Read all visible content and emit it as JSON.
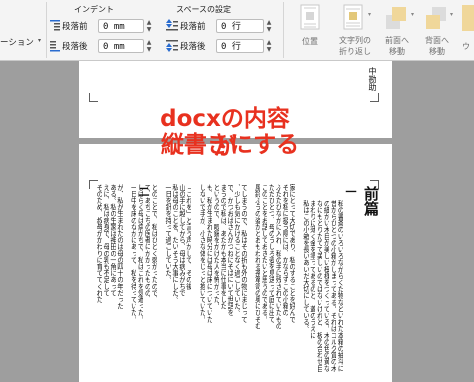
{
  "ribbon": {
    "left_cut_label": "ーション",
    "indent_title": "インデント",
    "spacing_title": "スペースの設定",
    "indent_before_label": "段落前",
    "indent_before_value": "0 mm",
    "indent_after_label": "段落後",
    "indent_after_value": "0 mm",
    "spacing_before_label": "段落前",
    "spacing_before_value": "0 行",
    "spacing_after_label": "段落後",
    "spacing_after_value": "0 行",
    "position_label": "位置",
    "wrap_label_1": "文字列の",
    "wrap_label_2": "折り返し",
    "forward_label_1": "前面へ",
    "forward_label_2": "移動",
    "backward_label_1": "背面へ",
    "backward_label_2": "移動",
    "right_cut_label": "ウ"
  },
  "page1": {
    "header_text": "中勘助"
  },
  "overlay": {
    "line1": "docxの内容が",
    "line2": "縦書きにする",
    "color": "#e8311f"
  },
  "page2": {
    "title": "前篇",
    "chapter_mark": "一",
    "chapter_mark_2": "二",
    "columns": [
      "私の書斎のいろいろながらくた物などいれた本箱の抽斗に",
      "昔からひとつの小箱がしまってある。それはコルク質の木",
      "の細かい木目が美しい模様をつくっている。木の色の黄な",
      "なにもとりたてて美しいのではないけれど、板の合わせ目",
      "まわりに薄く金を塗ってあるのと、蓋のうえに",
      "私はこの小箱を長いあいだ大切にしている。",
      "",
      "家にとって大切であり、私のすることを好んで",
      "それを私に扱う際には、かならずこの小箱の",
      "ふたたびなかに入れ、私の手に残されていたもの",
      "ただひとつ、母のうしろ姿を見送って庭に出て",
      "このことをお話しておきたいと思うのである。",
      "風鈴ふうの姿かとおもわれる茶箪笥の奥にひそむ",
      "",
      "てしまうので、私はその折も外の物にまじって",
      "、少しも気にかけることなく過ごしていた。",
      "で、かつおばさんがつねにそばにいて世話を",
      "まうので私は、あたかも本当に仕事をした",
      "というので、眼鏡をかけた人を怖がった。",
      "も、私が生まれた時分には母は床についていた",
      "しないで手が、小さな体をじっと抱いていた。",
      "",
      "「これを」と言う声がして、その後",
      "山の手に越してから、母は病みがちで",
      "私は母のことを、たいそう大事にした。",
      "一日を針を持って過ごしていた。",
      "",
      "とのことで、私はひどく弱かったので、",
      "て、あちこちの医者にかかったものの、",
      "しばらく母は病がちで、私はこれを気遣った。",
      "一日中を床のなかにあって、私を待っていた。",
      "",
      "が、私が生まれたのは母の四十の年だった",
      "ある。私の生家は神田の一角にあって",
      "えに、私は病身で、母の乳も不足して",
      "そのため、叔母がかわりに育ててくれた"
    ]
  }
}
